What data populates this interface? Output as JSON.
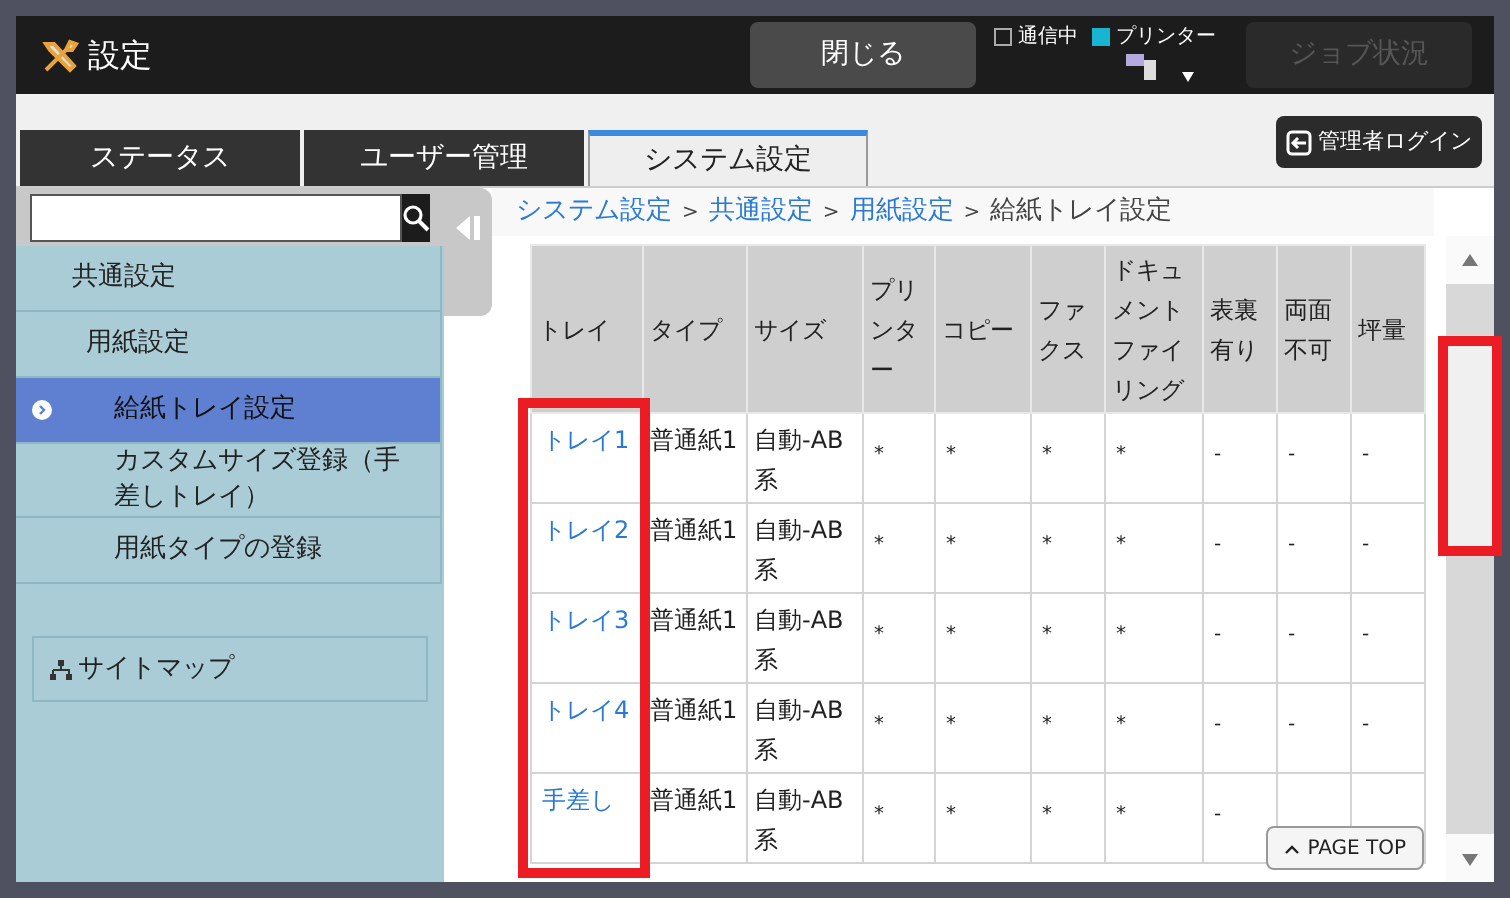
{
  "header": {
    "title": "設定",
    "close_button": "閉じる",
    "indicators": [
      {
        "label": "通信中",
        "on": false
      },
      {
        "label": "プリンター",
        "on": true
      }
    ],
    "job_button": {
      "label": "ジョブ状況",
      "disabled": true
    }
  },
  "tabs": [
    {
      "label": "ステータス",
      "selected": false
    },
    {
      "label": "ユーザー管理",
      "selected": false
    },
    {
      "label": "システム設定",
      "selected": true
    }
  ],
  "login_button": "管理者ログイン",
  "sidebar": {
    "items": [
      {
        "label": "共通設定",
        "selected": false,
        "children": [
          {
            "label": "用紙設定",
            "selected": false,
            "children": [
              {
                "label": "給紙トレイ設定",
                "selected": true
              },
              {
                "label": "カスタムサイズ登録（手差しトレイ）",
                "selected": false
              },
              {
                "label": "用紙タイプの登録",
                "selected": false
              }
            ]
          }
        ]
      }
    ],
    "sitemap": "サイトマップ"
  },
  "breadcrumb": {
    "separator": ">",
    "items": [
      {
        "label": "システム設定",
        "link": true
      },
      {
        "label": "共通設定",
        "link": true
      },
      {
        "label": "用紙設定",
        "link": true
      },
      {
        "label": "給紙トレイ設定",
        "link": false
      }
    ]
  },
  "table": {
    "columns": [
      "トレイ",
      "タイプ",
      "サイズ",
      "プリンター",
      "コピー",
      "ファクス",
      "ドキュメントファイリング",
      "表裏有り",
      "両面不可",
      "坪量"
    ],
    "rows": [
      [
        "トレイ1",
        "普通紙1",
        "自動-AB系",
        "*",
        "*",
        "*",
        "*",
        "-",
        "-",
        "-"
      ],
      [
        "トレイ2",
        "普通紙1",
        "自動-AB系",
        "*",
        "*",
        "*",
        "*",
        "-",
        "-",
        "-"
      ],
      [
        "トレイ3",
        "普通紙1",
        "自動-AB系",
        "*",
        "*",
        "*",
        "*",
        "-",
        "-",
        "-"
      ],
      [
        "トレイ4",
        "普通紙1",
        "自動-AB系",
        "*",
        "*",
        "*",
        "*",
        "-",
        "-",
        "-"
      ],
      [
        "手差し",
        "普通紙1",
        "自動-AB系",
        "*",
        "*",
        "*",
        "*",
        "-"
      ]
    ]
  },
  "page_top": "PAGE TOP"
}
